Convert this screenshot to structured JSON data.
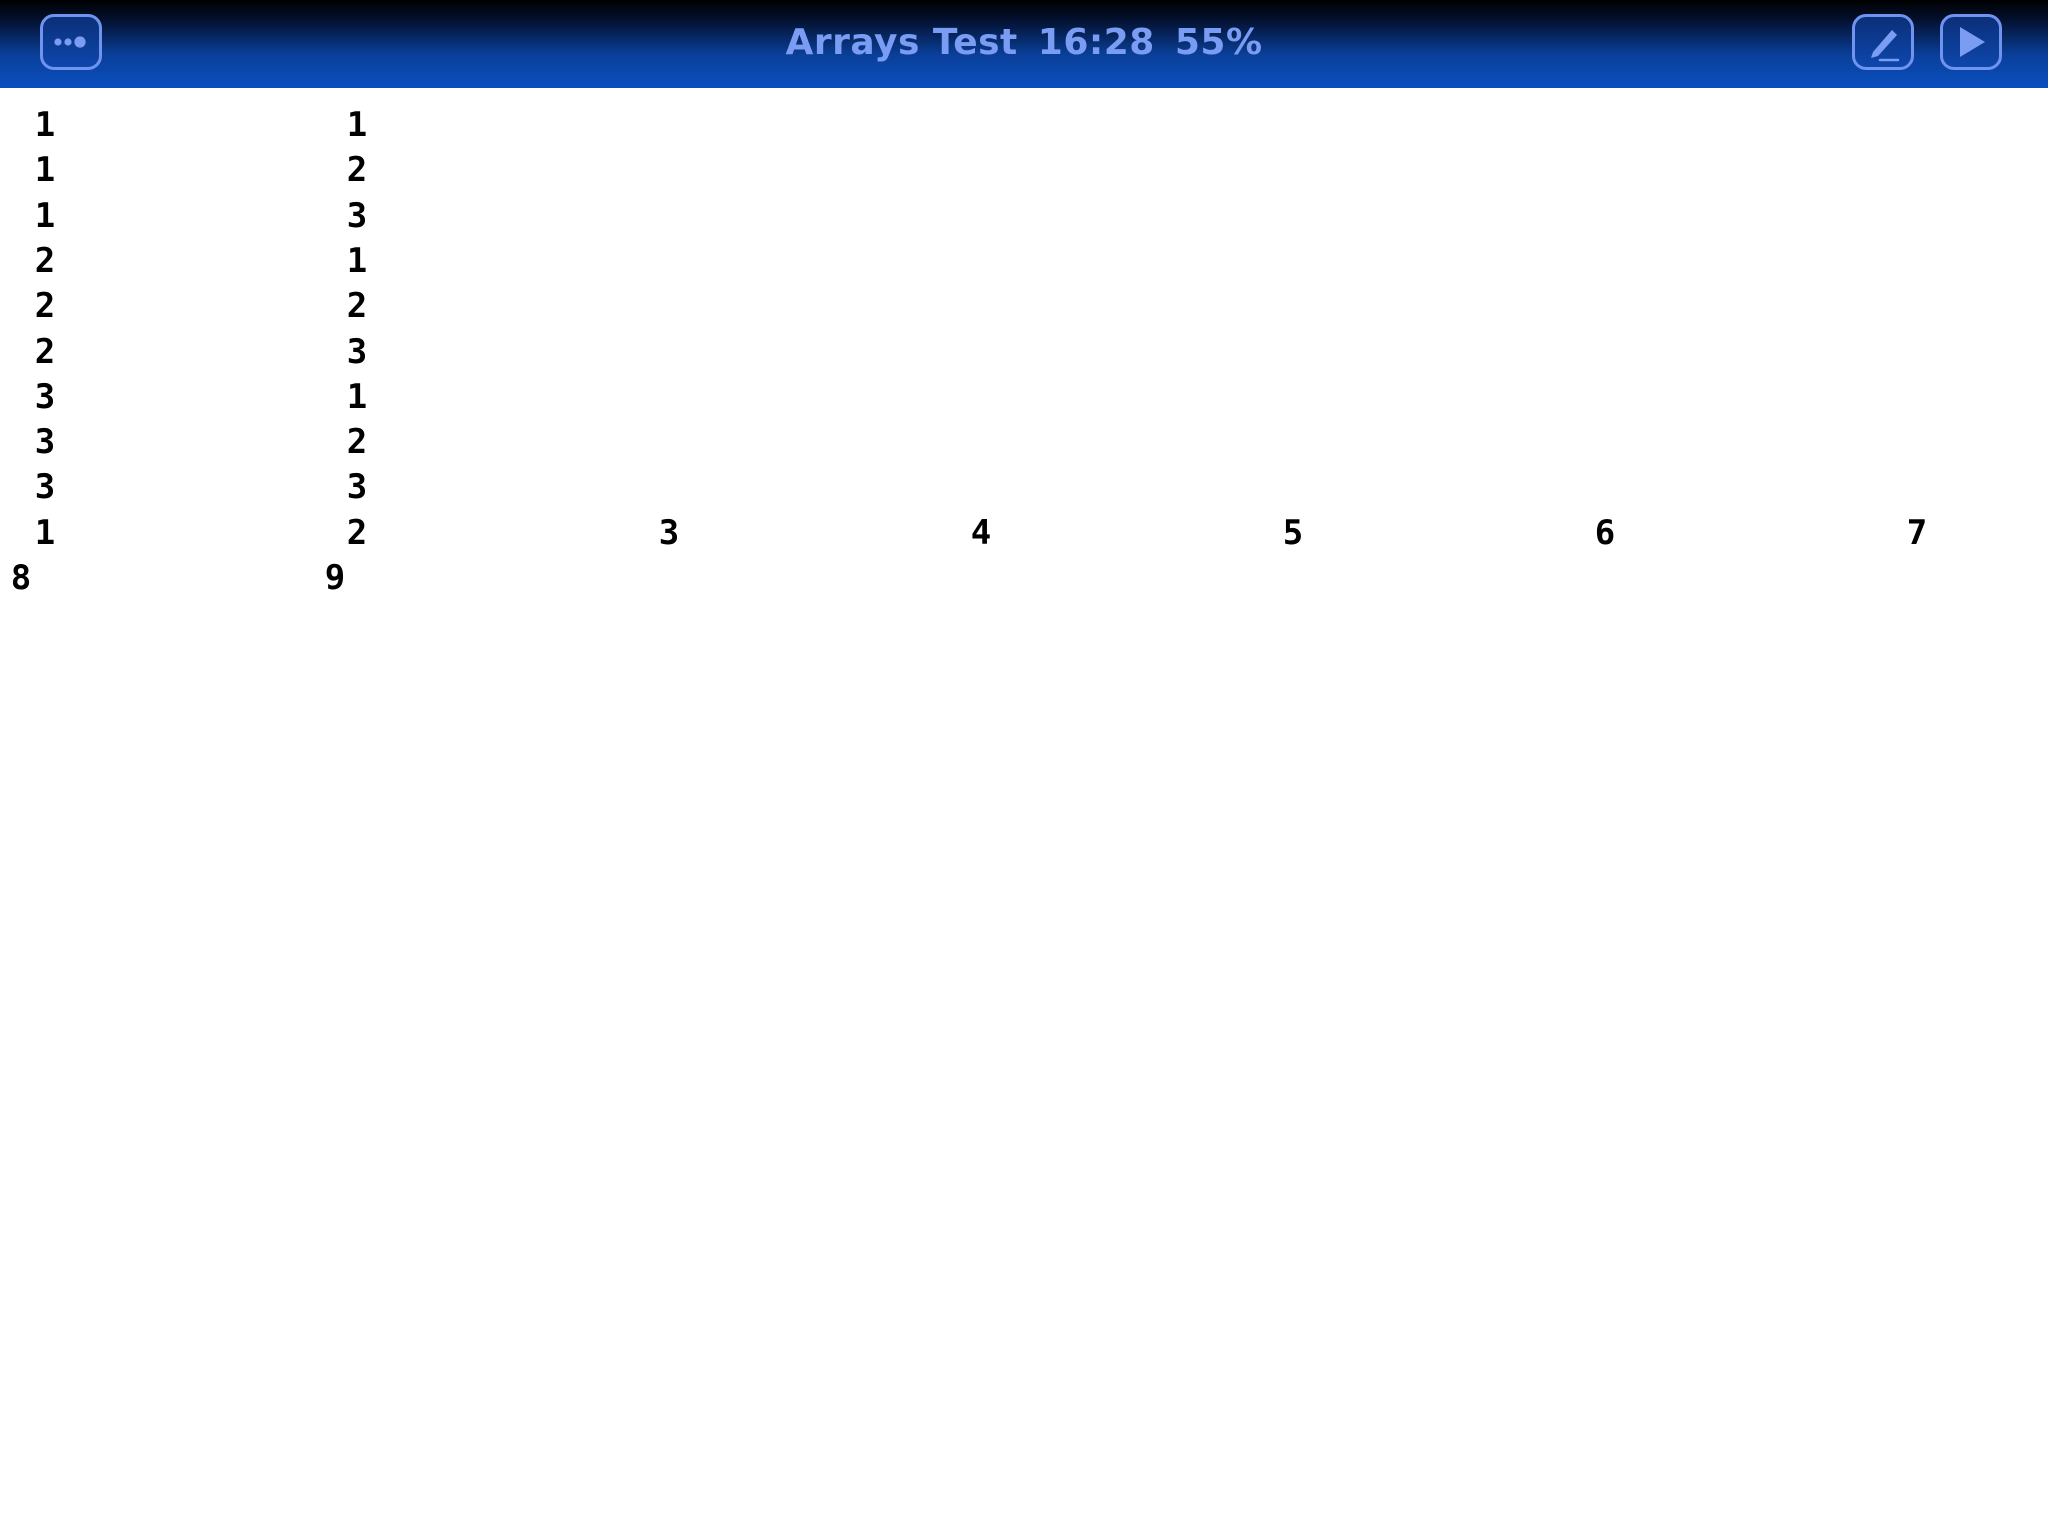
{
  "toolbar": {
    "title": "Arrays Test",
    "time": "16:28",
    "battery": "55%",
    "menu_icon": "more-dots-icon",
    "edit_icon": "pencil-icon",
    "run_icon": "play-icon"
  },
  "colors": {
    "title_text": "#7a9cf2",
    "button_border": "#6f93ee",
    "bar_top": "#000000",
    "bar_bottom": "#0a4fbf",
    "output_text": "#000000",
    "background": "#ffffff"
  },
  "output": {
    "lines": [
      [
        "1",
        "1"
      ],
      [
        "1",
        "2"
      ],
      [
        "1",
        "3"
      ],
      [
        "2",
        "1"
      ],
      [
        "2",
        "2"
      ],
      [
        "2",
        "3"
      ],
      [
        "3",
        "1"
      ],
      [
        "3",
        "2"
      ],
      [
        "3",
        "3"
      ],
      [
        "1",
        "2",
        "3",
        "4",
        "5",
        "6",
        "7"
      ],
      [
        "8",
        "9"
      ]
    ]
  }
}
